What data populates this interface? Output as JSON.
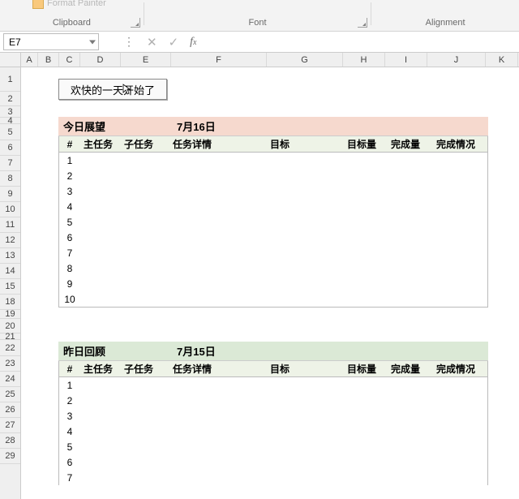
{
  "ribbon": {
    "format_painter": "Format Painter",
    "clipboard": "Clipboard",
    "font": "Font",
    "alignment": "Alignment"
  },
  "namebox": {
    "ref": "E7"
  },
  "fx": {
    "label_f": "f",
    "label_x": "x"
  },
  "columns": [
    "A",
    "B",
    "C",
    "D",
    "E",
    "F",
    "G",
    "H",
    "I",
    "J",
    "K"
  ],
  "rows": [
    {
      "n": "1",
      "h": 30
    },
    {
      "n": "2",
      "h": 18
    },
    {
      "n": "3",
      "h": 14
    },
    {
      "n": "4",
      "h": 8
    },
    {
      "n": "5",
      "h": 20
    },
    {
      "n": "6",
      "h": 19
    },
    {
      "n": "7",
      "h": 19
    },
    {
      "n": "8",
      "h": 19
    },
    {
      "n": "9",
      "h": 19
    },
    {
      "n": "10",
      "h": 19
    },
    {
      "n": "11",
      "h": 19
    },
    {
      "n": "12",
      "h": 19
    },
    {
      "n": "13",
      "h": 19
    },
    {
      "n": "14",
      "h": 19
    },
    {
      "n": "15",
      "h": 19
    },
    {
      "n": "18",
      "h": 19
    },
    {
      "n": "19",
      "h": 11
    },
    {
      "n": "20",
      "h": 18
    },
    {
      "n": "21",
      "h": 8
    },
    {
      "n": "22",
      "h": 20
    },
    {
      "n": "23",
      "h": 19
    },
    {
      "n": "24",
      "h": 19
    },
    {
      "n": "25",
      "h": 19
    },
    {
      "n": "26",
      "h": 19
    },
    {
      "n": "27",
      "h": 19
    },
    {
      "n": "28",
      "h": 19
    },
    {
      "n": "29",
      "h": 19
    }
  ],
  "button_text": "欢快的一天开始了",
  "today": {
    "title": "今日展望",
    "date": "7月16日",
    "headers": {
      "num": "#",
      "main": "主任务",
      "sub": "子任务",
      "detail": "任务详情",
      "goal": "目标",
      "goalamt": "目标量",
      "doneamt": "完成量",
      "donestat": "完成情况"
    },
    "rows": [
      "1",
      "2",
      "3",
      "4",
      "5",
      "6",
      "7",
      "8",
      "9",
      "10"
    ]
  },
  "yesterday": {
    "title": "昨日回顾",
    "date": "7月15日",
    "headers": {
      "num": "#",
      "main": "主任务",
      "sub": "子任务",
      "detail": "任务详情",
      "goal": "目标",
      "goalamt": "目标量",
      "doneamt": "完成量",
      "donestat": "完成情况"
    },
    "rows": [
      "1",
      "2",
      "3",
      "4",
      "5",
      "6",
      "7"
    ]
  }
}
